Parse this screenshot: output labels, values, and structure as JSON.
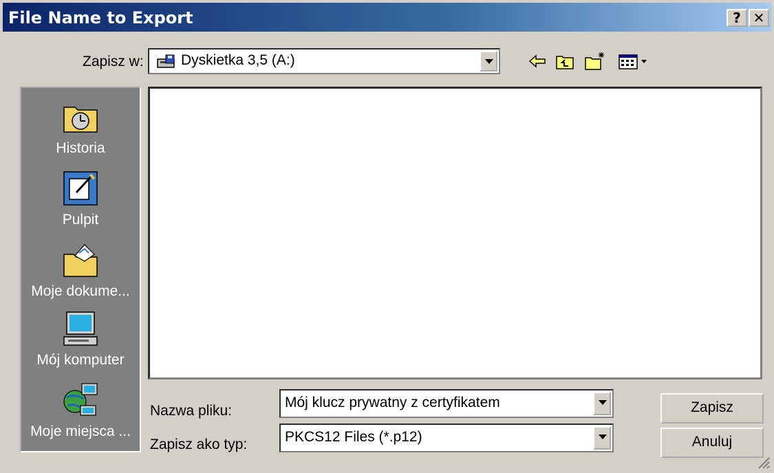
{
  "window": {
    "title": "File Name to Export",
    "help_btn": "?",
    "close_btn": "✕"
  },
  "savein": {
    "label": "Zapisz w:",
    "value": "Dyskietka 3,5 (A:)"
  },
  "toolbar": {
    "icons": [
      "back-icon",
      "up-folder-icon",
      "new-folder-icon",
      "view-menu-icon"
    ]
  },
  "places": {
    "items": [
      {
        "label": "Historia"
      },
      {
        "label": "Pulpit"
      },
      {
        "label": "Moje dokume..."
      },
      {
        "label": "Mój komputer"
      },
      {
        "label": "Moje miejsca ..."
      }
    ]
  },
  "filename": {
    "label": "Nazwa pliku:",
    "value": "Mój klucz prywatny z certyfikatem"
  },
  "filetype": {
    "label": "Zapisz ako typ:",
    "value": "PKCS12 Files (*.p12)"
  },
  "buttons": {
    "save": "Zapisz",
    "cancel": "Anuluj"
  },
  "colors": {
    "title_start": "#0a246a",
    "title_end": "#a6caf0",
    "face": "#d4d0c8",
    "places_bg": "#808080"
  }
}
